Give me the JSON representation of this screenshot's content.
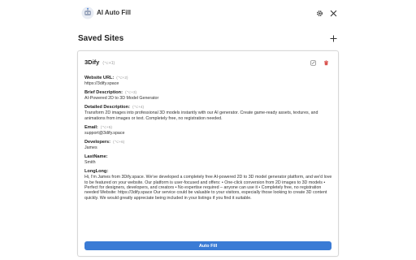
{
  "header": {
    "app_title": "AI Auto Fill",
    "logo_icon": "robot-logo-icon",
    "settings_icon": "gear-icon",
    "close_icon": "close-icon"
  },
  "section": {
    "title": "Saved Sites",
    "add_icon": "plus-icon"
  },
  "site": {
    "name": "3Dify",
    "shortcut": "(⌥+1)",
    "edit_icon": "edit-icon",
    "delete_icon": "trash-icon",
    "fields": [
      {
        "label": "Website URL:",
        "shortcut": "(⌥+2)",
        "value": "https://3dify.space"
      },
      {
        "label": "Brief Description:",
        "shortcut": "(⌥+3)",
        "value": "AI-Powered 2D to 3D Model Generator"
      },
      {
        "label": "Detailed Description:",
        "shortcut": "(⌥+4)",
        "value": "Transform 2D images into professional 3D models instantly with our AI generator. Create game-ready assets, textures, and animations from images or text. Completely free, no registration needed."
      },
      {
        "label": "Email:",
        "shortcut": "(⌥+5)",
        "value": "support@3dify.space"
      },
      {
        "label": "Developers:",
        "shortcut": "(⌥+6)",
        "value": "James"
      },
      {
        "label": "LastName:",
        "shortcut": "",
        "value": "Smith"
      },
      {
        "label": "LongLong:",
        "shortcut": "",
        "value": "Hi, I'm James from 3Dify.space. We've developed a completely free AI-powered 2D to 3D model generator platform, and we'd love to be featured on your website. Our platform is user-focused and offers: • One-click conversion from 2D images to 3D models • Perfect for designers, developers, and creators • No expertise required – anyone can use it • Completely free, no registration needed Website: https://3dify.space Our service could be valuable to your visitors, especially those looking to create 3D content quickly. We would greatly appreciate being included in your listings if you find it suitable."
      }
    ],
    "button_label": "Auto Fill"
  },
  "colors": {
    "accent": "#3a7bd5",
    "delete": "#d9534f"
  }
}
